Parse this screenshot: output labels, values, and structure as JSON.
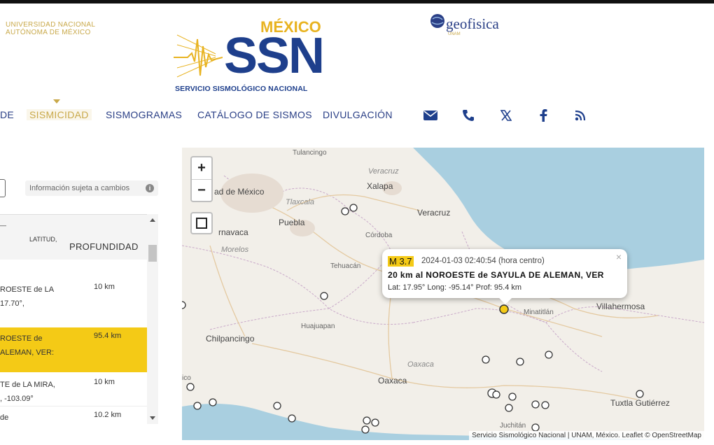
{
  "header": {
    "unam_lines": [
      "UNIVERSIDAD NACIONAL",
      "AUTÓNOMA DE MÉXICO"
    ],
    "ssn_country": "MÉXICO",
    "ssn_acronym": "SSN",
    "ssn_full": "SERVICIO SISMOLÓGICO NACIONAL",
    "geofisica": "geofisica",
    "geofisica_sub": "UNAM"
  },
  "nav": {
    "items": [
      {
        "label": "DE"
      },
      {
        "label": "SISMICIDAD"
      },
      {
        "label": "SISMOGRAMAS"
      },
      {
        "label": "CATÁLOGO DE SISMOS"
      },
      {
        "label": "DIVULGACIÓN"
      }
    ],
    "icons": [
      "mail-icon",
      "phone-icon",
      "x-icon",
      "facebook-icon",
      "rss-icon"
    ],
    "active_index": 1
  },
  "panel": {
    "notice": "Información sujeta a cambios",
    "columns": {
      "lat": "LATITUD,",
      "depth": "PROFUNDIDAD"
    },
    "rows": [
      {
        "place_lines": [
          "ROESTE de LA",
          "17.70°,"
        ],
        "depth": "10 km",
        "highlight": false
      },
      {
        "place_lines": [
          "ROESTE de",
          "ALEMAN, VER:"
        ],
        "depth": "95.4 km",
        "highlight": true
      },
      {
        "place_lines": [
          "TE de LA MIRA,",
          ", -103.09°"
        ],
        "depth": "10 km",
        "highlight": false
      },
      {
        "place_lines": [
          "de"
        ],
        "depth": "10.2 km",
        "highlight": false
      }
    ]
  },
  "map": {
    "labels": {
      "tulancingo": "Tulancingo",
      "veracruz_state": "Veracruz",
      "xalapa": "Xalapa",
      "ciudad_mexico": "ad de México",
      "tlaxcala": "Tlaxcala",
      "veracruz_city": "Veracruz",
      "puebla": "Puebla",
      "cuernavaca": "rnavaca",
      "cordoba": "Córdoba",
      "morelos": "Morelos",
      "tehuacan": "Tehuacán",
      "minatitlan": "Minatitlán",
      "villahermosa": "Villahermosa",
      "huajuapan": "Huajuapan",
      "chilpancingo": "Chilpancingo",
      "oaxaca_state": "Oaxaca",
      "oaxaca_city": "Oaxaca",
      "tuxtla": "Tuxtla Gutiérrez",
      "juchitan": "Juchitán",
      "co": "ico"
    },
    "popup": {
      "magnitude": "M 3.7",
      "datetime": "2024-01-03   02:40:54 (hora centro)",
      "location": "20 km al NOROESTE de SAYULA DE ALEMAN, VER",
      "coords": "Lat: 17.95°  Long: -95.14°  Prof: 95.4 km",
      "close": "×"
    },
    "zoom_in": "+",
    "zoom_out": "−",
    "attribution": "Servicio Sismológico Nacional | UNAM, México.  Leaflet © OpenStreetMap",
    "colors": {
      "sea": "#a9cfe0",
      "land": "#f2efe9",
      "highlight_marker": "#f4ca16",
      "popup_magnitude": "#f4ca16"
    }
  }
}
